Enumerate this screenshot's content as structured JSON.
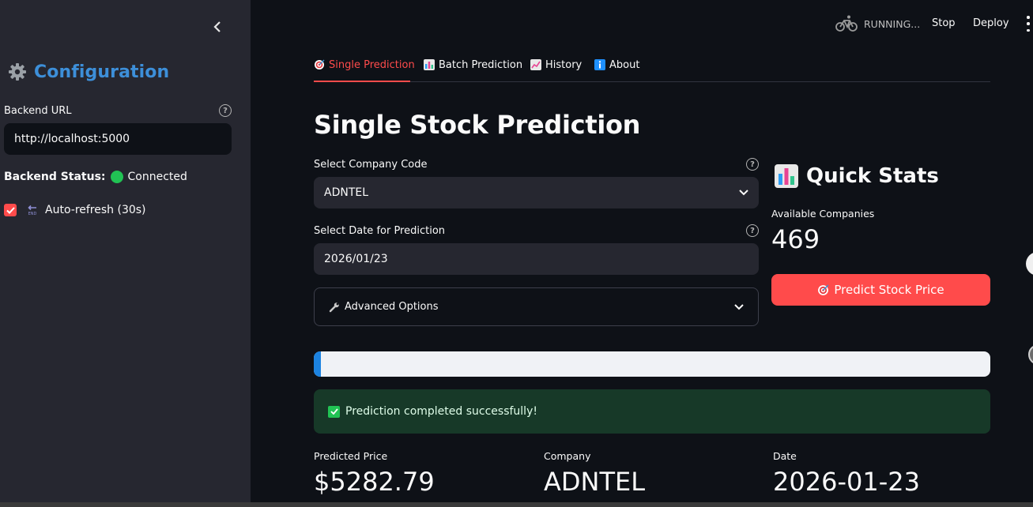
{
  "sidebar": {
    "title": "Configuration",
    "backend_url_label": "Backend URL",
    "backend_url_value": "http://localhost:5000",
    "backend_status_label": "Backend Status:",
    "backend_status_value": "Connected",
    "auto_refresh_label": "Auto-refresh (30s)",
    "auto_refresh_checked": true
  },
  "header": {
    "status": "RUNNING...",
    "stop": "Stop",
    "deploy": "Deploy"
  },
  "tabs": [
    {
      "label": "Single Prediction",
      "icon": "target-icon",
      "active": true
    },
    {
      "label": "Batch Prediction",
      "icon": "bar-chart-icon",
      "active": false
    },
    {
      "label": "History",
      "icon": "trend-chart-icon",
      "active": false
    },
    {
      "label": "About",
      "icon": "info-icon",
      "active": false
    }
  ],
  "main": {
    "title": "Single Stock Prediction",
    "company_label": "Select Company Code",
    "company_value": "ADNTEL",
    "date_label": "Select Date for Prediction",
    "date_value": "2026/01/23",
    "advanced_label": "Advanced Options",
    "progress": 0.01,
    "success_message": "Prediction completed successfully!"
  },
  "quick_stats": {
    "title": "Quick Stats",
    "companies_label": "Available Companies",
    "companies_value": "469",
    "predict_button": "Predict Stock Price"
  },
  "metrics": [
    {
      "label": "Predicted Price",
      "value": "$5282.79"
    },
    {
      "label": "Company",
      "value": "ADNTEL"
    },
    {
      "label": "Date",
      "value": "2026-01-23"
    }
  ],
  "colors": {
    "accent": "#ff4b4b",
    "success": "#21c354",
    "config_title": "#3d8fd9"
  }
}
